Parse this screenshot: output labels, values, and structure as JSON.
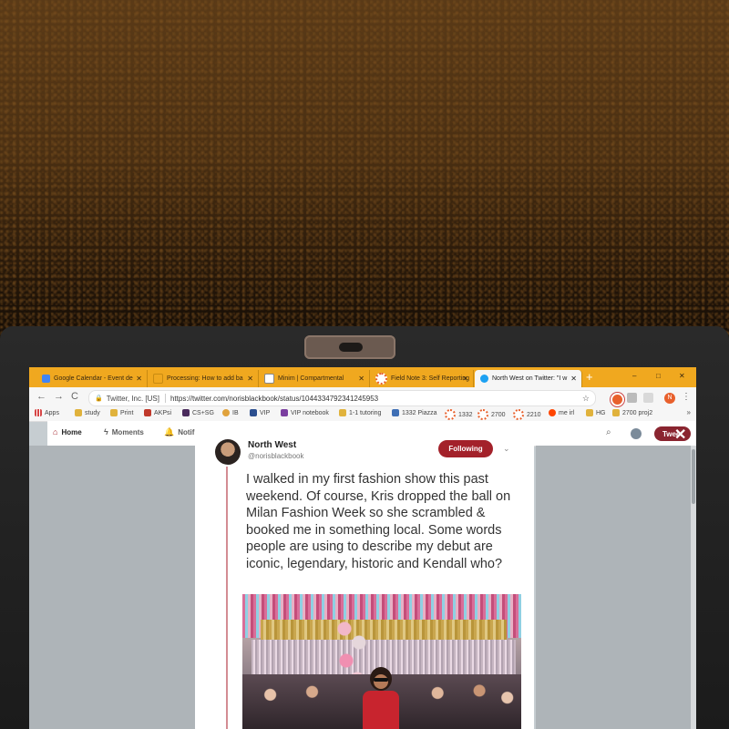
{
  "browser": {
    "tabs": [
      {
        "label": "Google Calendar - Event de",
        "color": "#4285f4",
        "active": false
      },
      {
        "label": "Processing: How to add ba",
        "color": "#f0a81f",
        "active": false
      },
      {
        "label": "Minim | Compartmental",
        "color": "#888888",
        "active": false
      },
      {
        "label": "Field Note 3: Self Reporting",
        "color": "#e8602c",
        "active": false
      },
      {
        "label": "North West on Twitter: \"I w",
        "color": "#1da1f2",
        "active": true
      }
    ],
    "new_tab": "+",
    "window_controls": {
      "minimize": "–",
      "maximize": "□",
      "close": "✕"
    },
    "nav": {
      "back": "←",
      "forward": "→",
      "reload": "C"
    },
    "address": {
      "lock": "🔒",
      "site": "Twitter, Inc. [US]",
      "url": "https://twitter.com/norisblackbook/status/1044334792341245953",
      "star": "☆"
    },
    "profile_initial": "N",
    "menu": "⋮",
    "bookmarks": [
      {
        "label": "Apps",
        "color": "#d64545"
      },
      {
        "label": "study",
        "color": "#e0b23c"
      },
      {
        "label": "Print",
        "color": "#e0b23c"
      },
      {
        "label": "AKPsi",
        "color": "#c0392b"
      },
      {
        "label": "CS+SG",
        "color": "#4a2b5c"
      },
      {
        "label": "IB",
        "color": "#e0a23c"
      },
      {
        "label": "VIP",
        "color": "#2b4f8f"
      },
      {
        "label": "VIP notebook",
        "color": "#7b3fa0"
      },
      {
        "label": "1-1 tutoring",
        "color": "#e0b23c"
      },
      {
        "label": "1332 Piazza",
        "color": "#3f6fb5"
      },
      {
        "label": "1332",
        "color": "#e8602c"
      },
      {
        "label": "2700",
        "color": "#e8602c"
      },
      {
        "label": "2210",
        "color": "#e8602c"
      },
      {
        "label": "me irl",
        "color": "#ff4500"
      },
      {
        "label": "HG",
        "color": "#e0b23c"
      },
      {
        "label": "2700 proj2",
        "color": "#e0b23c"
      }
    ],
    "bookmarks_more": "»"
  },
  "twitter": {
    "nav": [
      {
        "label": "Home",
        "icon": "home-icon",
        "glyph": "⌂",
        "active": true
      },
      {
        "label": "Moments",
        "icon": "lightning-icon",
        "glyph": "ϟ",
        "active": false
      },
      {
        "label": "Notif",
        "icon": "bell-icon",
        "glyph": "🔔",
        "active": false
      }
    ],
    "search_glyph": "⌕",
    "tweet_button": "Tweet",
    "close_glyph": "✕"
  },
  "tweet": {
    "name": "North West",
    "handle": "@norisblackbook",
    "follow_label": "Following",
    "chevron": "⌄",
    "text": "I walked in my first fashion show this past weekend. Of course, Kris dropped the ball on Milan Fashion Week so she scrambled & booked me in something local. Some words people are using to describe my debut are iconic, legendary, historic and Kendall who?"
  },
  "colors": {
    "tab_bar": "#f0a81f",
    "accent": "#a3212a",
    "tweet_button": "#8a2530"
  }
}
